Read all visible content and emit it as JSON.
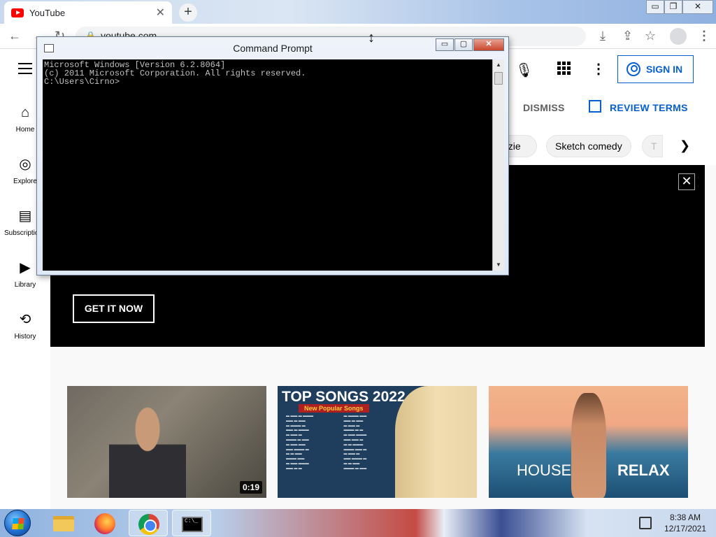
{
  "browser": {
    "tab_title": "YouTube",
    "tab_close": "✕",
    "new_tab": "+",
    "url": "youtube.com",
    "window_controls": [
      "▭",
      "❐",
      "✕"
    ]
  },
  "youtube": {
    "sign_in": "SIGN IN",
    "sidebar": [
      {
        "label": "Home",
        "icon": "home-icon"
      },
      {
        "label": "Explore",
        "icon": "compass-icon"
      },
      {
        "label": "Subscriptions",
        "icon": "subscriptions-icon"
      },
      {
        "label": "Library",
        "icon": "library-icon"
      },
      {
        "label": "History",
        "icon": "history-icon"
      }
    ],
    "consent": {
      "dismiss": "DISMISS",
      "review": "REVIEW TERMS"
    },
    "chips": [
      "ezie",
      "Sketch comedy",
      "T"
    ],
    "banner": {
      "cta": "GET IT NOW",
      "close": "✕"
    },
    "videos": [
      {
        "duration": "0:19"
      },
      {
        "title": "TOP SONGS 2022",
        "subtitle": "New Popular Songs"
      },
      {
        "left_text": "HOUSE",
        "right_text": "RELAX"
      }
    ]
  },
  "cmd": {
    "title": "Command Prompt",
    "lines": [
      "Microsoft Windows [Version 6.2.8064]",
      "(c) 2011 Microsoft Corporation. All rights reserved.",
      "",
      "C:\\Users\\Cirno>"
    ],
    "controls": {
      "minimize": "▭",
      "maximize": "▢",
      "close": "✕"
    }
  },
  "taskbar": {
    "time": "8:38 AM",
    "date": "12/17/2021",
    "cmd_icon_text": "C:\\_"
  }
}
